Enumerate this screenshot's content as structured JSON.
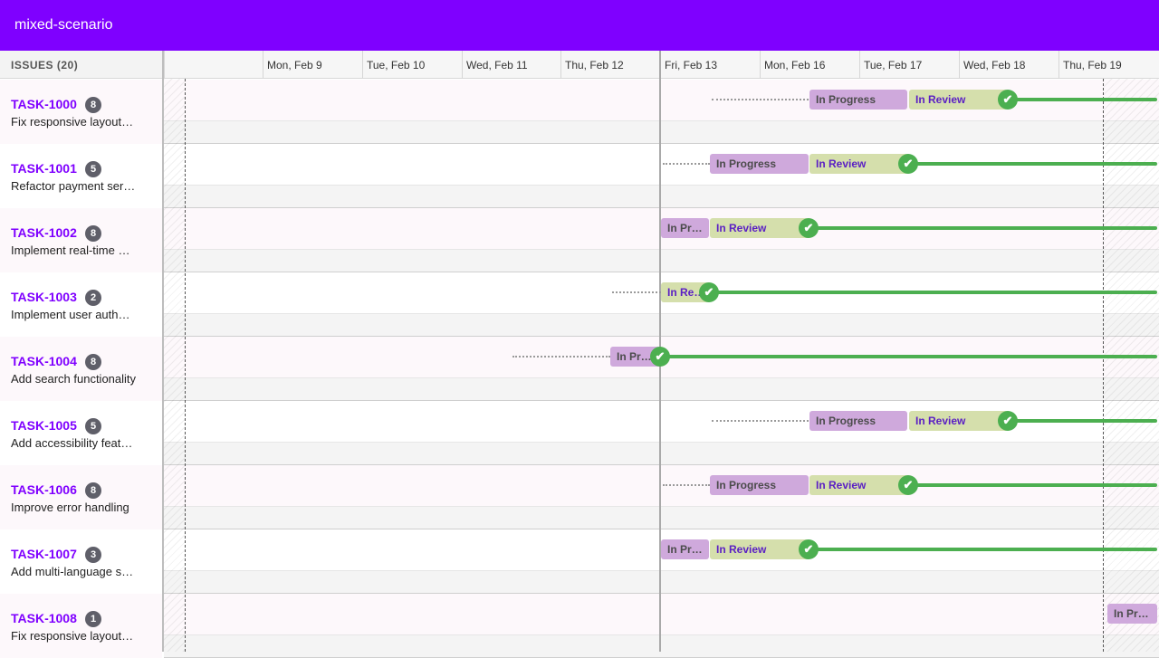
{
  "app": {
    "title": "mixed-scenario"
  },
  "sidebar": {
    "header": "ISSUES (20)"
  },
  "dates": [
    "Mon, Feb 9",
    "Tue, Feb 10",
    "Wed, Feb 11",
    "Thu, Feb 12",
    "Fri, Feb 13",
    "Mon, Feb 16",
    "Tue, Feb 17",
    "Wed, Feb 18",
    "Thu, Feb 19"
  ],
  "statuses": {
    "in_progress": "In Progress",
    "in_review": "In Review",
    "done_icon": "✔"
  },
  "colors": {
    "accent": "#7f00ff",
    "in_progress": "#cfa9dc",
    "in_review": "#d5dfac",
    "done": "#4caf50"
  },
  "tasks": [
    {
      "id": "TASK-1000",
      "points": "8",
      "title": "Fix responsive layout…",
      "in_progress_label": "In Progress",
      "in_review_label": "In Review"
    },
    {
      "id": "TASK-1001",
      "points": "5",
      "title": "Refactor payment ser…",
      "in_progress_label": "In Progress",
      "in_review_label": "In Review"
    },
    {
      "id": "TASK-1002",
      "points": "8",
      "title": "Implement real-time …",
      "in_progress_label": "In Pr…",
      "in_review_label": "In Review"
    },
    {
      "id": "TASK-1003",
      "points": "2",
      "title": "Implement user auth…",
      "in_review_label": "In Re…"
    },
    {
      "id": "TASK-1004",
      "points": "8",
      "title": "Add search functionality",
      "in_progress_label": "In Pr…"
    },
    {
      "id": "TASK-1005",
      "points": "5",
      "title": "Add accessibility feat…",
      "in_progress_label": "In Progress",
      "in_review_label": "In Review"
    },
    {
      "id": "TASK-1006",
      "points": "8",
      "title": "Improve error handling",
      "in_progress_label": "In Progress",
      "in_review_label": "In Review"
    },
    {
      "id": "TASK-1007",
      "points": "3",
      "title": "Add multi-language s…",
      "in_progress_label": "In Pr…",
      "in_review_label": "In Review"
    },
    {
      "id": "TASK-1008",
      "points": "1",
      "title": "Fix responsive layout…",
      "in_progress_label": "In Pr…"
    }
  ]
}
